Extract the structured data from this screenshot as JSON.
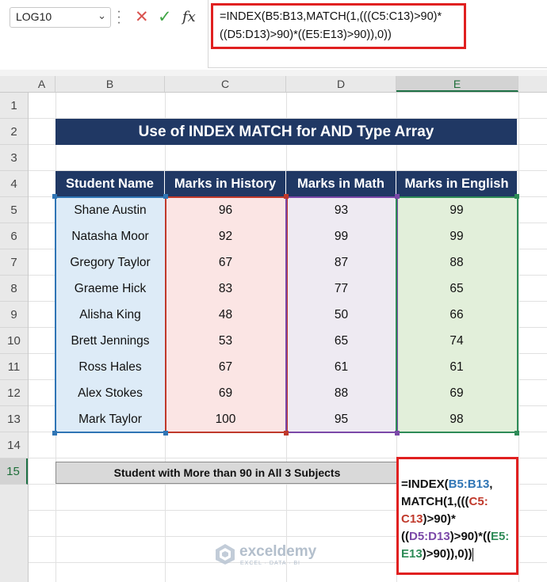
{
  "formula_bar": {
    "name_box": "LOG10",
    "cancel_icon": "✕",
    "enter_icon": "✓",
    "fx_icon": "fx",
    "formula_line1": "=INDEX(B5:B13,MATCH(1,(((C5:C13)>90)*",
    "formula_line2": "((D5:D13)>90)*((E5:E13)>90)),0))"
  },
  "columns": [
    "A",
    "B",
    "C",
    "D",
    "E"
  ],
  "rows": [
    "1",
    "2",
    "3",
    "4",
    "5",
    "6",
    "7",
    "8",
    "9",
    "10",
    "11",
    "12",
    "13",
    "14",
    "15"
  ],
  "sheet": {
    "title": "Use of  INDEX MATCH for AND Type Array",
    "headers": [
      "Student Name",
      "Marks in History",
      "Marks in Math",
      "Marks in English"
    ],
    "data": [
      [
        "Shane Austin",
        "96",
        "93",
        "99"
      ],
      [
        "Natasha Moor",
        "92",
        "99",
        "99"
      ],
      [
        "Gregory Taylor",
        "67",
        "87",
        "88"
      ],
      [
        "Graeme Hick",
        "83",
        "77",
        "65"
      ],
      [
        "Alisha King",
        "48",
        "50",
        "66"
      ],
      [
        "Brett Jennings",
        "53",
        "65",
        "74"
      ],
      [
        "Ross Hales",
        "67",
        "61",
        "61"
      ],
      [
        "Alex Stokes",
        "69",
        "88",
        "69"
      ],
      [
        "Mark Taylor",
        "100",
        "95",
        "98"
      ]
    ],
    "summary_label": "Student with More than 90 in All 3 Subjects",
    "edit_formula": {
      "p1": "=INDEX(",
      "p2": "B5:B13",
      "p3": ",",
      "p4": "MATCH(1,(((",
      "p5": "C5:",
      "p6": "C13",
      "p7": ")>90)*",
      "p8": "((",
      "p9": "D5:D13",
      "p10": ")>90)*((",
      "p11": "E5:",
      "p12": "E13",
      "p13": ")>90)),0))"
    }
  },
  "watermark": {
    "name": "exceldemy",
    "tagline": "EXCEL · DATA · BI"
  },
  "colors": {
    "header_navy": "#203864",
    "highlight_red": "#e02020",
    "selected_green": "#1e7145"
  }
}
